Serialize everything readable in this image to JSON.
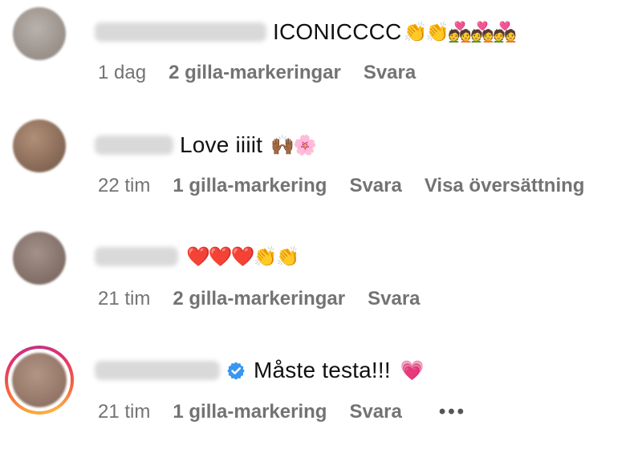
{
  "comments": [
    {
      "text": "ICONICCCC",
      "emojis": "👏👏💑💑💑",
      "time": "1 dag",
      "likes": "2 gilla-markeringar",
      "reply": "Svara",
      "avatar_color": "#a89f98"
    },
    {
      "text": "Love iiiit",
      "emojis": "🙌🏾🌸",
      "time": "22 tim",
      "likes": "1 gilla-markering",
      "reply": "Svara",
      "translate": "Visa översättning",
      "avatar_color": "#8f7361"
    },
    {
      "text": "",
      "emojis": "❤️❤️❤️👏👏",
      "time": "21 tim",
      "likes": "2 gilla-markeringar",
      "reply": "Svara",
      "avatar_color": "#8a7a73"
    },
    {
      "text": "Måste testa!!!",
      "emojis": "💗",
      "time": "21 tim",
      "likes": "1 gilla-markering",
      "reply": "Svara",
      "more": "•••",
      "verified": true,
      "avatar_color": "#9a7e6a"
    }
  ],
  "colors": {
    "meta_text": "#737373",
    "verified_badge": "#3897f0"
  },
  "icons": {
    "verified": "verified-badge-icon",
    "more": "more-options-icon"
  }
}
